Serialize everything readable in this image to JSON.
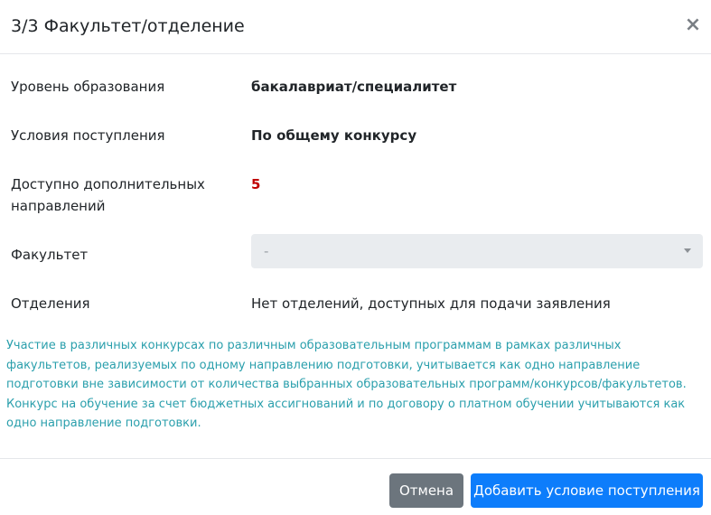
{
  "header": {
    "title": "3/3 Факультет/отделение",
    "close_glyph": "×"
  },
  "fields": {
    "education_level": {
      "label": "Уровень образования",
      "value": "бакалавриат/специалитет"
    },
    "admission_conditions": {
      "label": "Условия поступления",
      "value": "По общему конкурсу"
    },
    "extra_directions": {
      "label": "Доступно дополнительных направлений",
      "value": "5"
    },
    "faculty": {
      "label": "Факультет",
      "selected": "-"
    },
    "departments": {
      "label": "Отделения",
      "value": "Нет отделений, доступных для подачи заявления"
    }
  },
  "info": {
    "line1": "Участие в различных конкурсах по различным образовательным программам в рамках различных факультетов, реализуемых по одному направлению подготовки, учитывается как одно направление подготовки вне зависимости от количества выбранных образовательных программ/конкурсов/факультетов.",
    "line2": "Конкурс на обучение за счет бюджетных ассигнований и по договору о платном обучении учитываются как одно направление подготовки."
  },
  "footer": {
    "cancel_label": "Отмена",
    "submit_label": "Добавить условие поступления"
  },
  "colors": {
    "primary": "#0d7dfb",
    "secondary": "#6c757d",
    "info_text": "#2a9fac",
    "highlight_red": "#c00000"
  }
}
